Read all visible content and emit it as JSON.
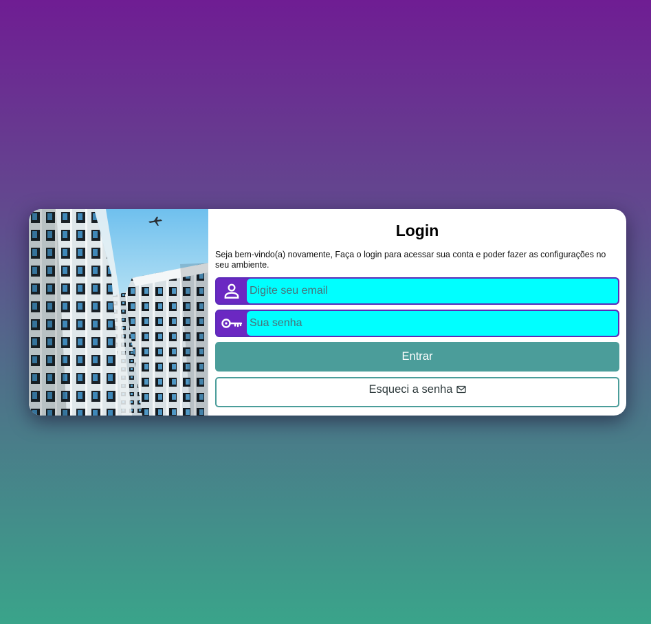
{
  "login": {
    "title": "Login",
    "subtitle": "Seja bem-vindo(a) novamente, Faça o login para acessar sua conta e poder fazer as configurações no seu ambiente.",
    "email": {
      "placeholder": "Digite seu email",
      "value": "",
      "icon": "user-icon"
    },
    "password": {
      "placeholder": "Sua senha",
      "value": "",
      "icon": "key-icon"
    },
    "submit_label": "Entrar",
    "forgot_label": "Esqueci a senha",
    "forgot_icon": "mail-icon"
  },
  "colors": {
    "icon_bg": "#6b28c2",
    "input_bg": "#00ffff",
    "accent_teal": "#4b9d9a",
    "bg_top": "#6f1d93",
    "bg_bottom": "#3aa48a"
  },
  "image": {
    "subject": "building-facade-photo"
  }
}
